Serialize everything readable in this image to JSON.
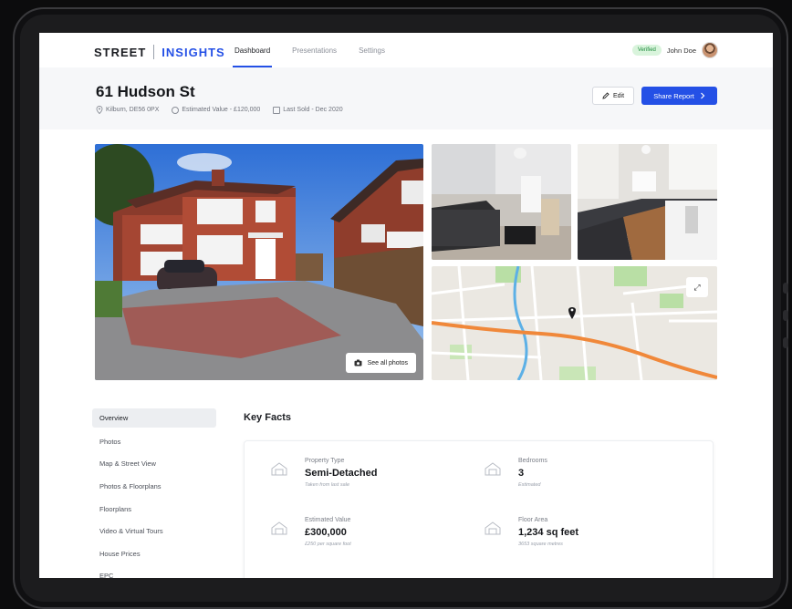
{
  "brand": {
    "name_left": "STREET",
    "name_right": "INSIGHTS",
    "accent": "#2450e6"
  },
  "nav": {
    "tabs": [
      {
        "label": "Dashboard"
      },
      {
        "label": "Presentations"
      },
      {
        "label": "Settings"
      }
    ]
  },
  "user": {
    "badge": "Verified",
    "name": "John Doe"
  },
  "property": {
    "title": "61 Hudson St",
    "location": "Kilburn, DE56 0PX",
    "estimated": "Estimated Value - £120,000",
    "last_sold": "Last Sold - Dec 2020"
  },
  "actions": {
    "edit": "Edit",
    "share": "Share Report"
  },
  "gallery": {
    "see_all": "See all photos"
  },
  "sidenav": {
    "items": [
      {
        "label": "Overview"
      },
      {
        "label": "Photos"
      },
      {
        "label": "Map & Street View"
      },
      {
        "label": "Photos & Floorplans"
      },
      {
        "label": "Floorplans"
      },
      {
        "label": "Video & Virtual Tours"
      },
      {
        "label": "House Prices"
      },
      {
        "label": "EPC"
      }
    ]
  },
  "key_facts": {
    "title": "Key Facts",
    "facts": [
      {
        "label": "Property Type",
        "value": "Semi-Detached",
        "sub": "Taken from last sale"
      },
      {
        "label": "Bedrooms",
        "value": "3",
        "sub": "Estimated"
      },
      {
        "label": "Estimated Value",
        "value": "£300,000",
        "sub": "£250 per square foot"
      },
      {
        "label": "Floor Area",
        "value": "1,234 sq feet",
        "sub": "3653 square metres"
      }
    ]
  }
}
